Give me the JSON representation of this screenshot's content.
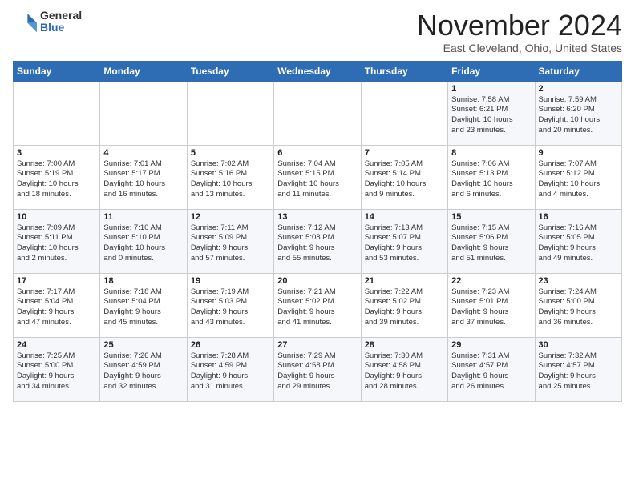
{
  "header": {
    "logo_general": "General",
    "logo_blue": "Blue",
    "month_title": "November 2024",
    "location": "East Cleveland, Ohio, United States"
  },
  "days_of_week": [
    "Sunday",
    "Monday",
    "Tuesday",
    "Wednesday",
    "Thursday",
    "Friday",
    "Saturday"
  ],
  "weeks": [
    [
      {
        "day": "",
        "info": ""
      },
      {
        "day": "",
        "info": ""
      },
      {
        "day": "",
        "info": ""
      },
      {
        "day": "",
        "info": ""
      },
      {
        "day": "",
        "info": ""
      },
      {
        "day": "1",
        "info": "Sunrise: 7:58 AM\nSunset: 6:21 PM\nDaylight: 10 hours\nand 23 minutes."
      },
      {
        "day": "2",
        "info": "Sunrise: 7:59 AM\nSunset: 6:20 PM\nDaylight: 10 hours\nand 20 minutes."
      }
    ],
    [
      {
        "day": "3",
        "info": "Sunrise: 7:00 AM\nSunset: 5:19 PM\nDaylight: 10 hours\nand 18 minutes."
      },
      {
        "day": "4",
        "info": "Sunrise: 7:01 AM\nSunset: 5:17 PM\nDaylight: 10 hours\nand 16 minutes."
      },
      {
        "day": "5",
        "info": "Sunrise: 7:02 AM\nSunset: 5:16 PM\nDaylight: 10 hours\nand 13 minutes."
      },
      {
        "day": "6",
        "info": "Sunrise: 7:04 AM\nSunset: 5:15 PM\nDaylight: 10 hours\nand 11 minutes."
      },
      {
        "day": "7",
        "info": "Sunrise: 7:05 AM\nSunset: 5:14 PM\nDaylight: 10 hours\nand 9 minutes."
      },
      {
        "day": "8",
        "info": "Sunrise: 7:06 AM\nSunset: 5:13 PM\nDaylight: 10 hours\nand 6 minutes."
      },
      {
        "day": "9",
        "info": "Sunrise: 7:07 AM\nSunset: 5:12 PM\nDaylight: 10 hours\nand 4 minutes."
      }
    ],
    [
      {
        "day": "10",
        "info": "Sunrise: 7:09 AM\nSunset: 5:11 PM\nDaylight: 10 hours\nand 2 minutes."
      },
      {
        "day": "11",
        "info": "Sunrise: 7:10 AM\nSunset: 5:10 PM\nDaylight: 10 hours\nand 0 minutes."
      },
      {
        "day": "12",
        "info": "Sunrise: 7:11 AM\nSunset: 5:09 PM\nDaylight: 9 hours\nand 57 minutes."
      },
      {
        "day": "13",
        "info": "Sunrise: 7:12 AM\nSunset: 5:08 PM\nDaylight: 9 hours\nand 55 minutes."
      },
      {
        "day": "14",
        "info": "Sunrise: 7:13 AM\nSunset: 5:07 PM\nDaylight: 9 hours\nand 53 minutes."
      },
      {
        "day": "15",
        "info": "Sunrise: 7:15 AM\nSunset: 5:06 PM\nDaylight: 9 hours\nand 51 minutes."
      },
      {
        "day": "16",
        "info": "Sunrise: 7:16 AM\nSunset: 5:05 PM\nDaylight: 9 hours\nand 49 minutes."
      }
    ],
    [
      {
        "day": "17",
        "info": "Sunrise: 7:17 AM\nSunset: 5:04 PM\nDaylight: 9 hours\nand 47 minutes."
      },
      {
        "day": "18",
        "info": "Sunrise: 7:18 AM\nSunset: 5:04 PM\nDaylight: 9 hours\nand 45 minutes."
      },
      {
        "day": "19",
        "info": "Sunrise: 7:19 AM\nSunset: 5:03 PM\nDaylight: 9 hours\nand 43 minutes."
      },
      {
        "day": "20",
        "info": "Sunrise: 7:21 AM\nSunset: 5:02 PM\nDaylight: 9 hours\nand 41 minutes."
      },
      {
        "day": "21",
        "info": "Sunrise: 7:22 AM\nSunset: 5:02 PM\nDaylight: 9 hours\nand 39 minutes."
      },
      {
        "day": "22",
        "info": "Sunrise: 7:23 AM\nSunset: 5:01 PM\nDaylight: 9 hours\nand 37 minutes."
      },
      {
        "day": "23",
        "info": "Sunrise: 7:24 AM\nSunset: 5:00 PM\nDaylight: 9 hours\nand 36 minutes."
      }
    ],
    [
      {
        "day": "24",
        "info": "Sunrise: 7:25 AM\nSunset: 5:00 PM\nDaylight: 9 hours\nand 34 minutes."
      },
      {
        "day": "25",
        "info": "Sunrise: 7:26 AM\nSunset: 4:59 PM\nDaylight: 9 hours\nand 32 minutes."
      },
      {
        "day": "26",
        "info": "Sunrise: 7:28 AM\nSunset: 4:59 PM\nDaylight: 9 hours\nand 31 minutes."
      },
      {
        "day": "27",
        "info": "Sunrise: 7:29 AM\nSunset: 4:58 PM\nDaylight: 9 hours\nand 29 minutes."
      },
      {
        "day": "28",
        "info": "Sunrise: 7:30 AM\nSunset: 4:58 PM\nDaylight: 9 hours\nand 28 minutes."
      },
      {
        "day": "29",
        "info": "Sunrise: 7:31 AM\nSunset: 4:57 PM\nDaylight: 9 hours\nand 26 minutes."
      },
      {
        "day": "30",
        "info": "Sunrise: 7:32 AM\nSunset: 4:57 PM\nDaylight: 9 hours\nand 25 minutes."
      }
    ]
  ]
}
